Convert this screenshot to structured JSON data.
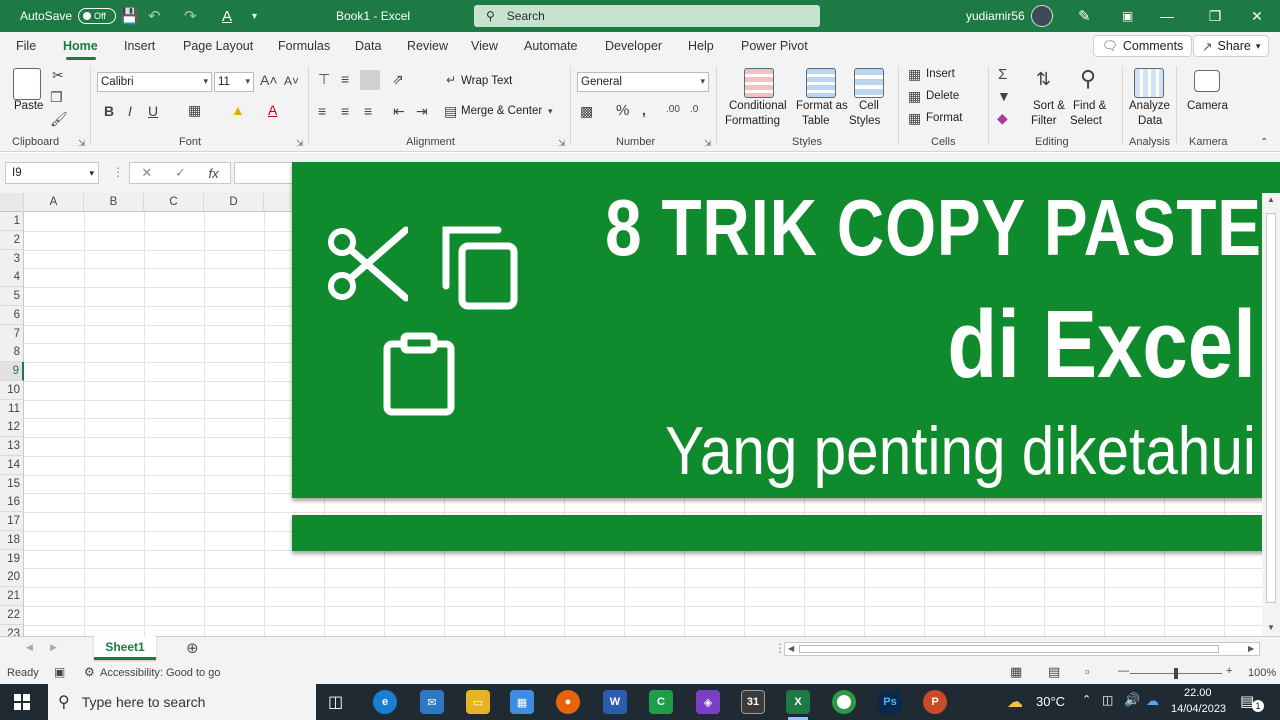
{
  "titlebar": {
    "autosave_label": "AutoSave",
    "autosave_state": "Off",
    "doc_title": "Book1  -  Excel",
    "search_placeholder": "Search",
    "user_name": "yudiamir56"
  },
  "tabs": [
    "File",
    "Home",
    "Insert",
    "Page Layout",
    "Formulas",
    "Data",
    "Review",
    "View",
    "Automate",
    "Developer",
    "Help",
    "Power Pivot"
  ],
  "active_tab": "Home",
  "tab_actions": {
    "comments": "Comments",
    "share": "Share"
  },
  "ribbon": {
    "clipboard": {
      "label": "Clipboard",
      "paste": "Paste"
    },
    "font": {
      "label": "Font",
      "font_name": "Calibri",
      "font_size": "11",
      "bold": "B",
      "italic": "I",
      "underline": "U"
    },
    "alignment": {
      "label": "Alignment",
      "wrap_text": "Wrap Text",
      "merge_center": "Merge & Center"
    },
    "number": {
      "label": "Number",
      "format": "General"
    },
    "styles": {
      "label": "Styles",
      "conditional_1": "Conditional",
      "conditional_2": "Formatting",
      "format_table_1": "Format as",
      "format_table_2": "Table",
      "cell_styles_1": "Cell",
      "cell_styles_2": "Styles"
    },
    "cells": {
      "label": "Cells",
      "insert": "Insert",
      "delete": "Delete",
      "format": "Format"
    },
    "editing": {
      "label": "Editing",
      "sort_1": "Sort &",
      "sort_2": "Filter",
      "find_1": "Find &",
      "find_2": "Select"
    },
    "analysis": {
      "label": "Analysis",
      "analyze_1": "Analyze",
      "analyze_2": "Data"
    },
    "kamera": {
      "label": "Kamera",
      "camera": "Camera"
    }
  },
  "formula_bar": {
    "name_box": "I9",
    "fx": "fx"
  },
  "grid": {
    "columns": [
      "A",
      "B",
      "C",
      "D"
    ],
    "rows": [
      "1",
      "2",
      "3",
      "4",
      "5",
      "6",
      "7",
      "8",
      "9",
      "10",
      "11",
      "12",
      "13",
      "14",
      "15",
      "16",
      "17",
      "18",
      "19",
      "20",
      "21",
      "22",
      "23"
    ],
    "selected_row": "9"
  },
  "banner": {
    "title_line1": "8 TRIK COPY PASTE",
    "title_line2": "di Excel",
    "subtitle": "Yang penting diketahui"
  },
  "sheets": {
    "tab": "Sheet1"
  },
  "status": {
    "ready": "Ready",
    "accessibility": "Accessibility: Good to go",
    "zoom": "100%"
  },
  "taskbar": {
    "search_placeholder": "Type here to search",
    "temperature": "30°C",
    "time": "22.00",
    "date": "14/04/2023",
    "notification_count": "1"
  },
  "colors": {
    "excel_green": "#1e7a45",
    "banner_green": "#0f8b2e"
  }
}
